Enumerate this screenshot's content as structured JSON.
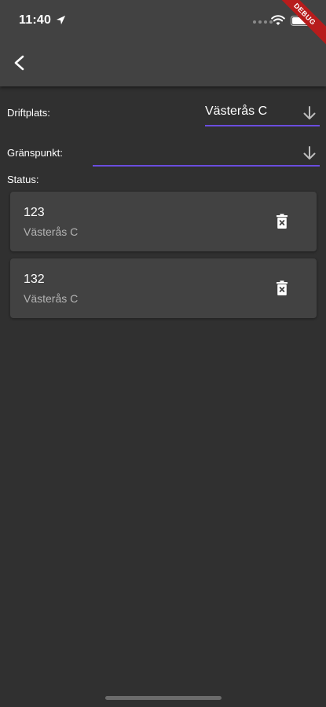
{
  "status_bar": {
    "time": "11:40"
  },
  "debug_banner": {
    "label": "DEBUG"
  },
  "form": {
    "driftplats": {
      "label": "Driftplats:",
      "value": "Västerås C"
    },
    "granspunkt": {
      "label": "Gränspunkt:",
      "value": ""
    },
    "status_label": "Status:"
  },
  "status_items": [
    {
      "number": "123",
      "location": "Västerås C"
    },
    {
      "number": "132",
      "location": "Västerås C"
    }
  ],
  "colors": {
    "background": "#303030",
    "appbar": "#424242",
    "card": "#424242",
    "underline_accent": "#6a4ddf",
    "debug_ribbon": "#b71c1c"
  }
}
